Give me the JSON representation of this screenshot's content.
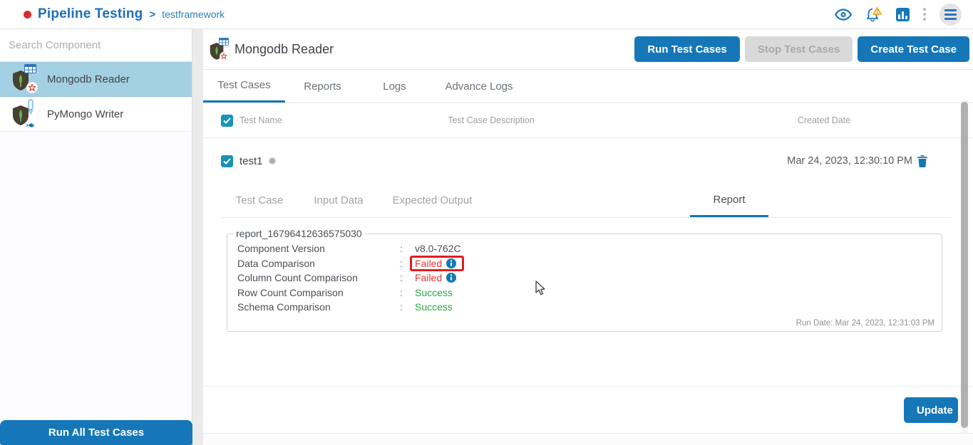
{
  "header": {
    "app_title": "Pipeline Testing",
    "breadcrumb_separator": ">",
    "breadcrumb": "testframework",
    "icons": [
      "eye-icon",
      "notifications-icon",
      "analytics-icon",
      "more-options-icon",
      "menu-icon"
    ]
  },
  "sidebar": {
    "search_placeholder": "Search Component",
    "items": [
      {
        "label": "Mongodb Reader",
        "selected": true
      },
      {
        "label": "PyMongo Writer",
        "selected": false
      }
    ],
    "run_all_button": "Run All Test Cases"
  },
  "main": {
    "title": "Mongodb Reader",
    "actions": {
      "run": "Run Test Cases",
      "stop": "Stop Test Cases",
      "create": "Create Test Case"
    },
    "tabs": [
      "Test Cases",
      "Reports",
      "Logs",
      "Advance Logs"
    ],
    "active_tab": "Test Cases",
    "table": {
      "columns": [
        "Test Name",
        "Test Case Description",
        "Created Date"
      ]
    },
    "test_case": {
      "name": "test1",
      "created_date": "Mar 24, 2023, 12:30:10 PM",
      "sub_tabs": [
        "Test Case",
        "Input Data",
        "Expected Output",
        "Report"
      ],
      "active_sub_tab": "Report",
      "report": {
        "id": "report_16796412636575030",
        "separator": ":",
        "rows": [
          {
            "label": "Component Version",
            "value": "v8.0-762C",
            "status": "plain"
          },
          {
            "label": "Data Comparison",
            "value": "Failed",
            "status": "failed",
            "info": true,
            "highlighted": true
          },
          {
            "label": "Column Count Comparison",
            "value": "Failed",
            "status": "failed",
            "info": true
          },
          {
            "label": "Row Count Comparison",
            "value": "Success",
            "status": "success"
          },
          {
            "label": "Schema Comparison",
            "value": "Success",
            "status": "success"
          }
        ],
        "run_date": "Run Date: Mar 24, 2023, 12:31:03 PM"
      }
    },
    "update_button": "Update"
  },
  "colors": {
    "accent_blue": "#1577b8",
    "selected_item_bg": "#a3d0e2",
    "failed_red": "#e03a34",
    "highlight_border_red": "#e01f1f",
    "success_green": "#28a745",
    "checkbox_teal": "#1892b5"
  }
}
